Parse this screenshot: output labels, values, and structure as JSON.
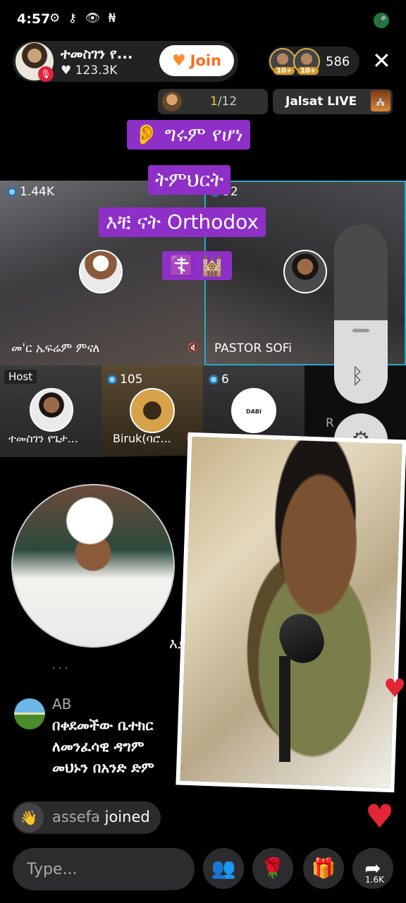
{
  "status_bar": {
    "time": "4:57",
    "icons": "⚙ ⚷ 👁 ₦"
  },
  "header": {
    "host_name": "ተመስገን የ...",
    "host_likes": "♥ 123.3K",
    "join_label": "Join",
    "viewer_badges": [
      "10+",
      "10+"
    ],
    "viewer_count": "586",
    "close_icon": "close-icon"
  },
  "subheader": {
    "rank_current": "1",
    "rank_total": "/12",
    "topic_label": "Jalsat LIVE"
  },
  "caption_lines": [
    "👂 ግሩም የሆነ",
    "ትምህርት",
    "እቺ ናት Orthodox",
    "☦️ 🕍"
  ],
  "tiles": [
    {
      "count": "1.44K",
      "name": "መ'ር ኤፍሬም ምናለ"
    },
    {
      "count": "32",
      "name": "PASTOR SOFi"
    },
    {
      "tag": "Host",
      "name": "ተመስገን የጌታ..."
    },
    {
      "count": "105",
      "name": "Biruk(ባሮ..."
    },
    {
      "count": "6",
      "name": "...",
      "logo_text": "DABI BALLAYA"
    },
    {
      "name": "R"
    }
  ],
  "chat": {
    "fragment_1": "እያ",
    "fragment_2": "· · ·",
    "user": "AB",
    "lines": [
      "በቀደመችው ቤተክር",
      "ለመንፈሳዊ ዳግም",
      "መህኑን በአንድ ድም"
    ],
    "join_user": "assefa",
    "join_suffix": " joined"
  },
  "bottom_bar": {
    "input_placeholder": "Type...",
    "share_count": "1.6K"
  },
  "colors": {
    "accent_caption": "#8e2fc7",
    "join_orange": "#ff6a1f",
    "heart_red": "#e32636",
    "active_tile_border": "#2aa8c9"
  }
}
